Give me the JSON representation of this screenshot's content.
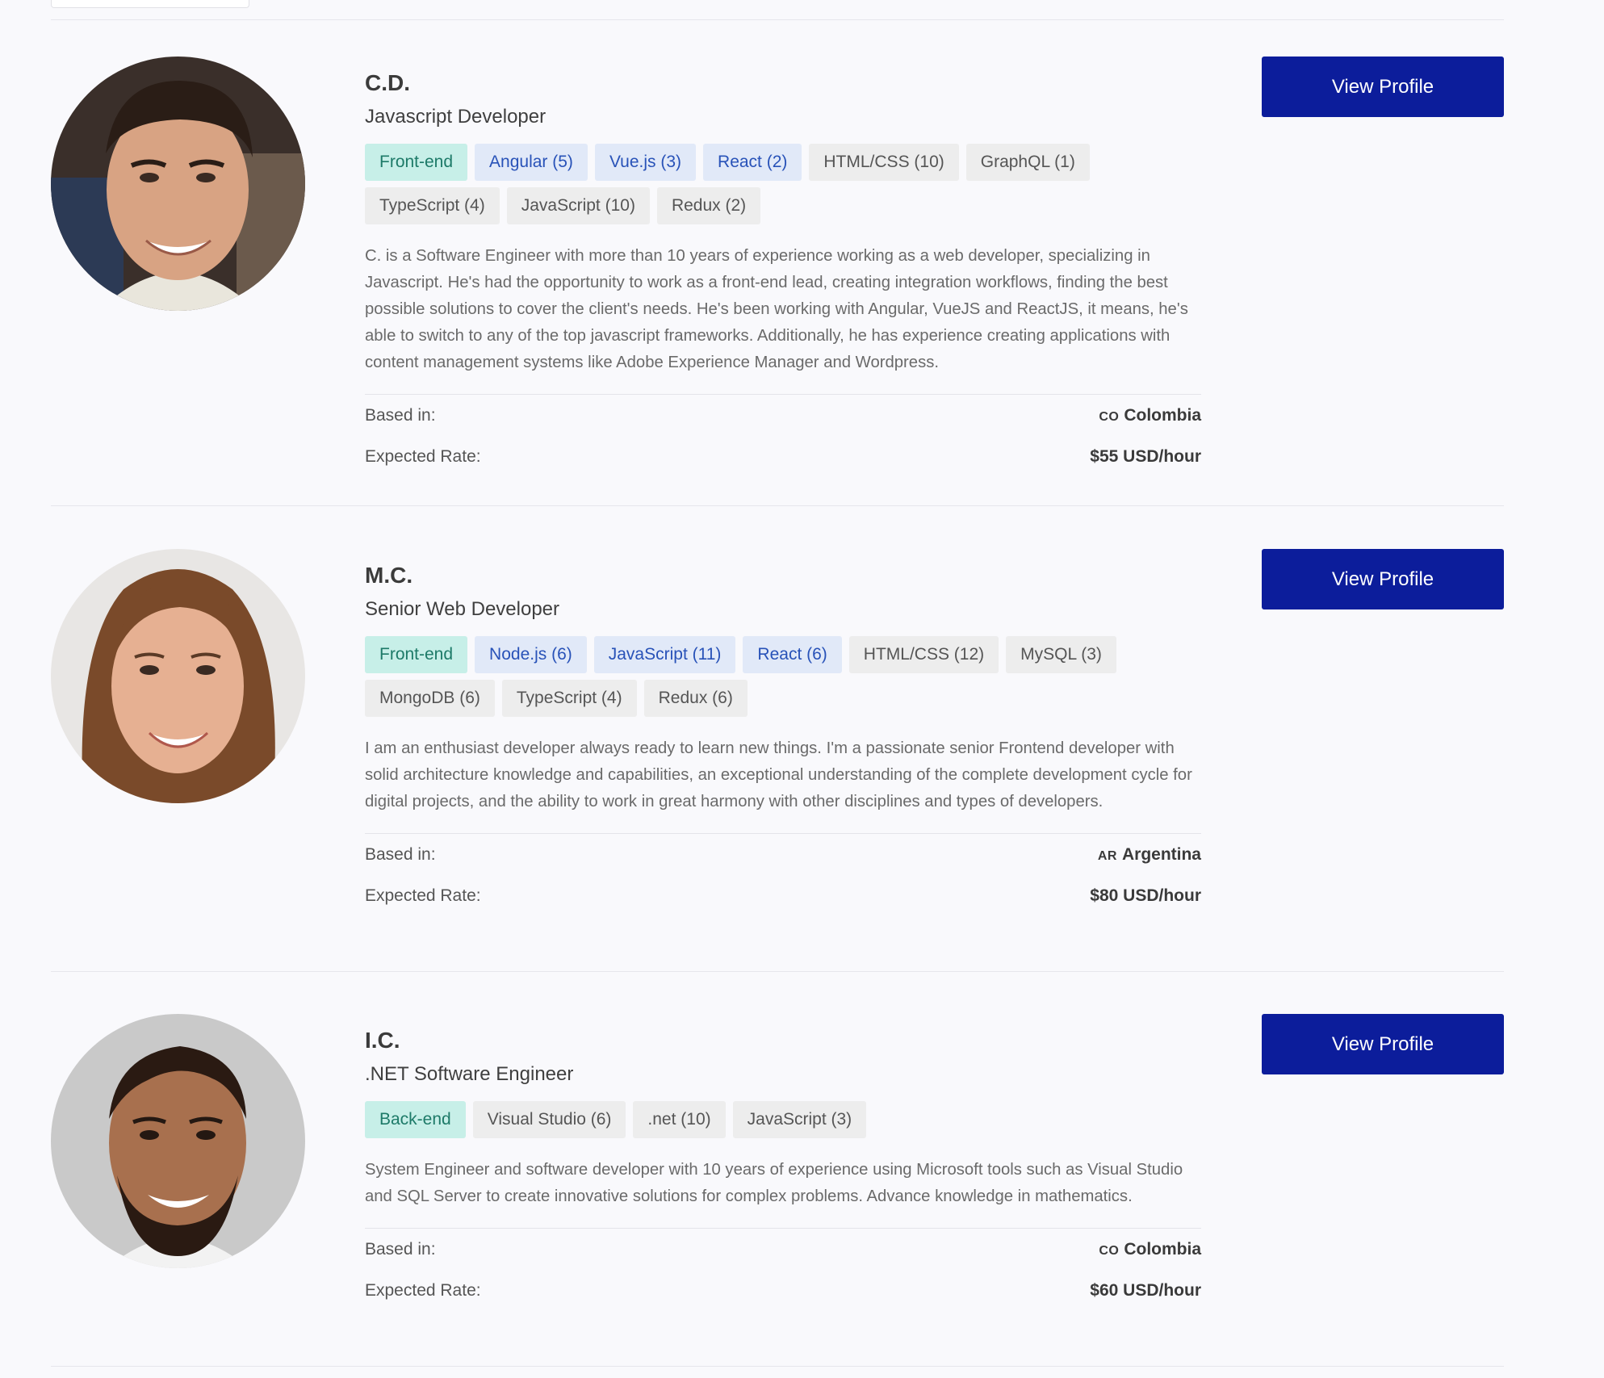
{
  "profiles": [
    {
      "name": "C.D.",
      "role": "Javascript Developer",
      "tags": [
        {
          "label": "Front-end",
          "kind": "category"
        },
        {
          "label": "Angular (5)",
          "kind": "highlight"
        },
        {
          "label": "Vue.js (3)",
          "kind": "highlight"
        },
        {
          "label": "React (2)",
          "kind": "highlight"
        },
        {
          "label": "HTML/CSS (10)",
          "kind": "plain"
        },
        {
          "label": "GraphQL (1)",
          "kind": "plain"
        },
        {
          "label": "TypeScript (4)",
          "kind": "plain"
        },
        {
          "label": "JavaScript (10)",
          "kind": "plain"
        },
        {
          "label": "Redux (2)",
          "kind": "plain"
        }
      ],
      "bio": "C. is a Software Engineer with more than 10 years of experience working as a web developer, specializing in Javascript. He's had the opportunity to work as a front-end lead, creating integration workflows, finding the best possible solutions to cover the client's needs. He's been working with Angular, VueJS and ReactJS, it means, he's able to switch to any of the top javascript frameworks. Additionally, he has experience creating applications with content management systems like Adobe Experience Manager and Wordpress.",
      "based_in_label": "Based in:",
      "country_code": "CO",
      "country": "Colombia",
      "rate_label": "Expected Rate:",
      "rate": "$55 USD/hour",
      "button_label": "View Profile"
    },
    {
      "name": "M.C.",
      "role": "Senior Web Developer",
      "tags": [
        {
          "label": "Front-end",
          "kind": "category"
        },
        {
          "label": "Node.js (6)",
          "kind": "highlight"
        },
        {
          "label": "JavaScript (11)",
          "kind": "highlight"
        },
        {
          "label": "React (6)",
          "kind": "highlight"
        },
        {
          "label": "HTML/CSS (12)",
          "kind": "plain"
        },
        {
          "label": "MySQL (3)",
          "kind": "plain"
        },
        {
          "label": "MongoDB (6)",
          "kind": "plain"
        },
        {
          "label": "TypeScript (4)",
          "kind": "plain"
        },
        {
          "label": "Redux (6)",
          "kind": "plain"
        }
      ],
      "bio": "I am an enthusiast developer always ready to learn new things. I'm a passionate senior Frontend developer with solid architecture knowledge and capabilities, an exceptional understanding of the complete development cycle for digital projects, and the ability to work in great harmony with other disciplines and types of developers.",
      "based_in_label": "Based in:",
      "country_code": "AR",
      "country": "Argentina",
      "rate_label": "Expected Rate:",
      "rate": "$80 USD/hour",
      "button_label": "View Profile"
    },
    {
      "name": "I.C.",
      "role": ".NET Software Engineer",
      "tags": [
        {
          "label": "Back-end",
          "kind": "category"
        },
        {
          "label": "Visual Studio (6)",
          "kind": "plain"
        },
        {
          "label": ".net (10)",
          "kind": "plain"
        },
        {
          "label": "JavaScript (3)",
          "kind": "plain"
        }
      ],
      "bio": "System Engineer and software developer with 10 years of experience using Microsoft tools such as Visual Studio and SQL Server to create innovative solutions for complex problems. Advance knowledge in mathematics.",
      "based_in_label": "Based in:",
      "country_code": "CO",
      "country": "Colombia",
      "rate_label": "Expected Rate:",
      "rate": "$60 USD/hour",
      "button_label": "View Profile"
    }
  ],
  "colors": {
    "button": "#0c1d9b",
    "category_tag_bg": "#c7efe8",
    "category_tag_text": "#1d7a68",
    "highlight_tag_bg": "#e1e9f8",
    "highlight_tag_text": "#2852b8",
    "plain_tag_bg": "#ededed"
  }
}
